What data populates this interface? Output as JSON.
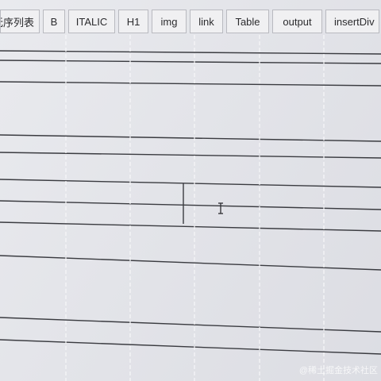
{
  "toolbar": {
    "buttons": [
      {
        "id": "unordered-list",
        "label": "无序列表"
      },
      {
        "id": "bold",
        "label": "B"
      },
      {
        "id": "italic",
        "label": "ITALIC"
      },
      {
        "id": "heading1",
        "label": "H1"
      },
      {
        "id": "image",
        "label": "img"
      },
      {
        "id": "link",
        "label": "link"
      },
      {
        "id": "table",
        "label": "Table"
      },
      {
        "id": "output",
        "label": "output"
      },
      {
        "id": "insert-div",
        "label": "insertDiv"
      }
    ]
  },
  "editor": {
    "cursor_icon": "text-cursor-icon"
  },
  "watermark": "@稀土掘金技术社区"
}
